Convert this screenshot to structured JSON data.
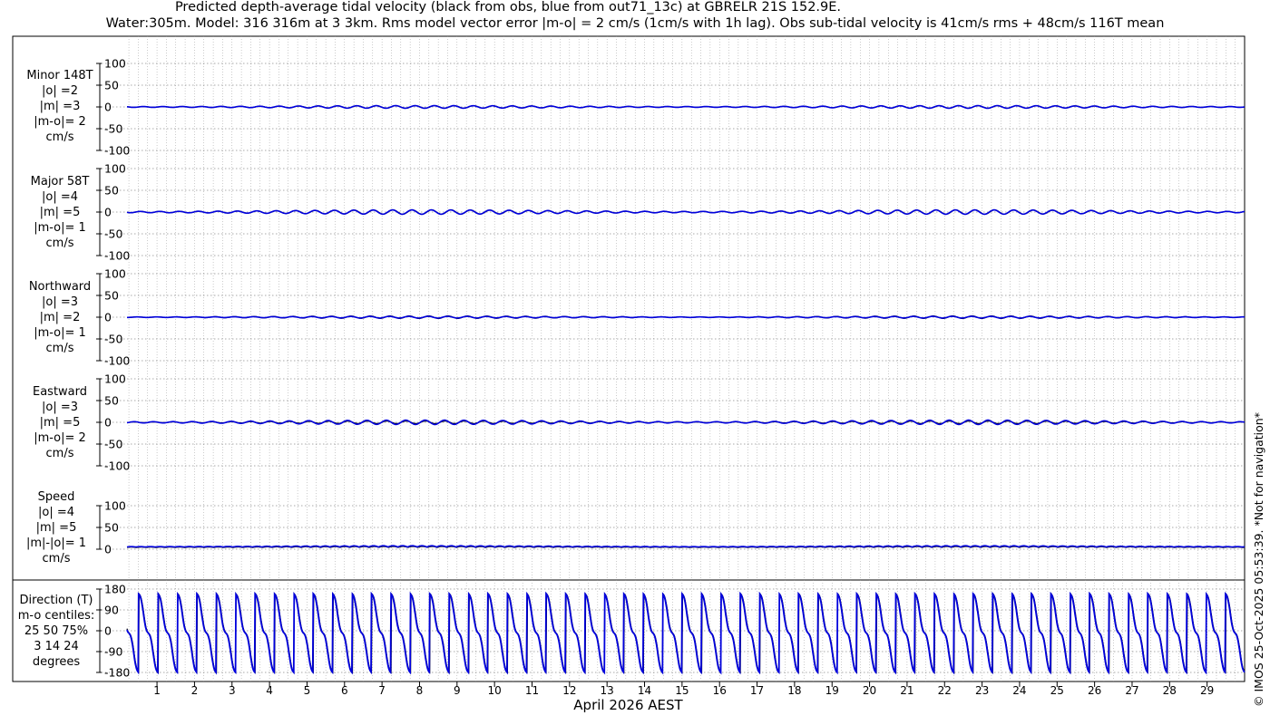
{
  "title_line1": "Predicted depth-average tidal velocity (black from obs, blue from out71_13c) at GBRELR 21S 152.9E.",
  "title_line2": "Water:305m. Model: 316 316m at 3 3km. Rms model vector error |m-o| = 2 cm/s (1cm/s with 1h lag). Obs sub-tidal velocity is 41cm/s rms + 48cm/s 116T mean",
  "copyright": "© IMOS 25-Oct-2025 05:53:39. *Not for navigation*",
  "colors": {
    "obs": "#000000",
    "model": "#0000dd",
    "grid": "#999999",
    "frame": "#000000"
  },
  "chart_data": [
    {
      "type": "line",
      "panel": "minor",
      "label": [
        "Minor 148T",
        "|o| =2",
        "|m| =3",
        "|m-o|= 2",
        "cm/s"
      ],
      "yticks": [
        "100",
        "50",
        "0",
        "-50",
        "-100"
      ],
      "ylim": [
        -100,
        100
      ],
      "series": [
        {
          "amplitude": 3,
          "base": 0
        },
        {
          "amplitude": 3,
          "base": 0
        }
      ]
    },
    {
      "type": "line",
      "panel": "major",
      "label": [
        "Major 58T",
        "|o| =4",
        "|m| =5",
        "|m-o|= 1",
        "cm/s"
      ],
      "yticks": [
        "100",
        "50",
        "0",
        "-50",
        "-100"
      ],
      "ylim": [
        -100,
        100
      ],
      "series": [
        {
          "amplitude": 5,
          "base": 0
        },
        {
          "amplitude": 5,
          "base": 0
        }
      ]
    },
    {
      "type": "line",
      "panel": "northward",
      "label": [
        "Northward",
        "|o| =3",
        "|m| =2",
        "|m-o|= 1",
        "cm/s"
      ],
      "yticks": [
        "100",
        "50",
        "0",
        "-50",
        "-100"
      ],
      "ylim": [
        -100,
        100
      ],
      "series": [
        {
          "amplitude": 3,
          "base": 0
        },
        {
          "amplitude": 2,
          "base": 0
        }
      ]
    },
    {
      "type": "line",
      "panel": "eastward",
      "label": [
        "Eastward",
        "|o| =3",
        "|m| =5",
        "|m-o|= 2",
        "cm/s"
      ],
      "yticks": [
        "100",
        "50",
        "0",
        "-50",
        "-100"
      ],
      "ylim": [
        -100,
        100
      ],
      "series": [
        {
          "amplitude": 3,
          "base": 0
        },
        {
          "amplitude": 5,
          "base": 0
        }
      ]
    },
    {
      "type": "line",
      "panel": "speed",
      "label": [
        "Speed",
        "|o| =4",
        "|m| =5",
        "|m|-|o|= 1",
        "cm/s"
      ],
      "yticks": [
        "100",
        "50",
        "0"
      ],
      "ylim": [
        0,
        100
      ],
      "series": [
        {
          "amplitude": 4,
          "base": 4
        },
        {
          "amplitude": 5,
          "base": 5
        }
      ]
    },
    {
      "type": "line",
      "panel": "direction",
      "label": [
        "Direction (T)",
        "m-o centiles:",
        "25  50  75%",
        "3  14  24",
        "degrees"
      ],
      "yticks": [
        "180",
        "90",
        "0",
        "-90",
        "-180"
      ],
      "ylim": [
        -180,
        180
      ],
      "series": [
        {
          "centiles": [
            3,
            14,
            24
          ]
        }
      ]
    }
  ],
  "x_axis": {
    "label": "April 2026 AEST",
    "days": [
      "1",
      "2",
      "3",
      "4",
      "5",
      "6",
      "7",
      "8",
      "9",
      "10",
      "11",
      "12",
      "13",
      "14",
      "15",
      "16",
      "17",
      "18",
      "19",
      "20",
      "21",
      "22",
      "23",
      "24",
      "25",
      "26",
      "27",
      "28",
      "29"
    ],
    "xlim": [
      0.2,
      30.0
    ]
  }
}
